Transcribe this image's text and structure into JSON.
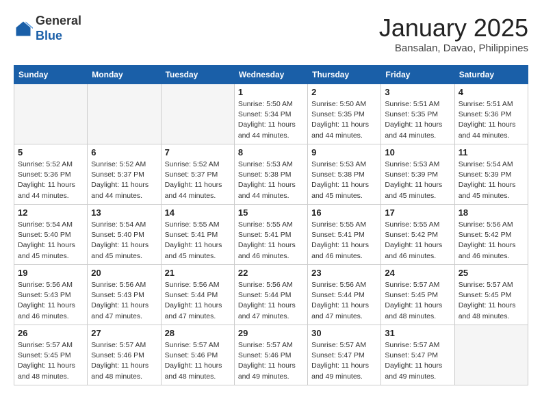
{
  "header": {
    "logo_general": "General",
    "logo_blue": "Blue",
    "month_title": "January 2025",
    "location": "Bansalan, Davao, Philippines"
  },
  "weekdays": [
    "Sunday",
    "Monday",
    "Tuesday",
    "Wednesday",
    "Thursday",
    "Friday",
    "Saturday"
  ],
  "weeks": [
    [
      {
        "day": "",
        "info": ""
      },
      {
        "day": "",
        "info": ""
      },
      {
        "day": "",
        "info": ""
      },
      {
        "day": "1",
        "info": "Sunrise: 5:50 AM\nSunset: 5:34 PM\nDaylight: 11 hours\nand 44 minutes."
      },
      {
        "day": "2",
        "info": "Sunrise: 5:50 AM\nSunset: 5:35 PM\nDaylight: 11 hours\nand 44 minutes."
      },
      {
        "day": "3",
        "info": "Sunrise: 5:51 AM\nSunset: 5:35 PM\nDaylight: 11 hours\nand 44 minutes."
      },
      {
        "day": "4",
        "info": "Sunrise: 5:51 AM\nSunset: 5:36 PM\nDaylight: 11 hours\nand 44 minutes."
      }
    ],
    [
      {
        "day": "5",
        "info": "Sunrise: 5:52 AM\nSunset: 5:36 PM\nDaylight: 11 hours\nand 44 minutes."
      },
      {
        "day": "6",
        "info": "Sunrise: 5:52 AM\nSunset: 5:37 PM\nDaylight: 11 hours\nand 44 minutes."
      },
      {
        "day": "7",
        "info": "Sunrise: 5:52 AM\nSunset: 5:37 PM\nDaylight: 11 hours\nand 44 minutes."
      },
      {
        "day": "8",
        "info": "Sunrise: 5:53 AM\nSunset: 5:38 PM\nDaylight: 11 hours\nand 44 minutes."
      },
      {
        "day": "9",
        "info": "Sunrise: 5:53 AM\nSunset: 5:38 PM\nDaylight: 11 hours\nand 45 minutes."
      },
      {
        "day": "10",
        "info": "Sunrise: 5:53 AM\nSunset: 5:39 PM\nDaylight: 11 hours\nand 45 minutes."
      },
      {
        "day": "11",
        "info": "Sunrise: 5:54 AM\nSunset: 5:39 PM\nDaylight: 11 hours\nand 45 minutes."
      }
    ],
    [
      {
        "day": "12",
        "info": "Sunrise: 5:54 AM\nSunset: 5:40 PM\nDaylight: 11 hours\nand 45 minutes."
      },
      {
        "day": "13",
        "info": "Sunrise: 5:54 AM\nSunset: 5:40 PM\nDaylight: 11 hours\nand 45 minutes."
      },
      {
        "day": "14",
        "info": "Sunrise: 5:55 AM\nSunset: 5:41 PM\nDaylight: 11 hours\nand 45 minutes."
      },
      {
        "day": "15",
        "info": "Sunrise: 5:55 AM\nSunset: 5:41 PM\nDaylight: 11 hours\nand 46 minutes."
      },
      {
        "day": "16",
        "info": "Sunrise: 5:55 AM\nSunset: 5:41 PM\nDaylight: 11 hours\nand 46 minutes."
      },
      {
        "day": "17",
        "info": "Sunrise: 5:55 AM\nSunset: 5:42 PM\nDaylight: 11 hours\nand 46 minutes."
      },
      {
        "day": "18",
        "info": "Sunrise: 5:56 AM\nSunset: 5:42 PM\nDaylight: 11 hours\nand 46 minutes."
      }
    ],
    [
      {
        "day": "19",
        "info": "Sunrise: 5:56 AM\nSunset: 5:43 PM\nDaylight: 11 hours\nand 46 minutes."
      },
      {
        "day": "20",
        "info": "Sunrise: 5:56 AM\nSunset: 5:43 PM\nDaylight: 11 hours\nand 47 minutes."
      },
      {
        "day": "21",
        "info": "Sunrise: 5:56 AM\nSunset: 5:44 PM\nDaylight: 11 hours\nand 47 minutes."
      },
      {
        "day": "22",
        "info": "Sunrise: 5:56 AM\nSunset: 5:44 PM\nDaylight: 11 hours\nand 47 minutes."
      },
      {
        "day": "23",
        "info": "Sunrise: 5:56 AM\nSunset: 5:44 PM\nDaylight: 11 hours\nand 47 minutes."
      },
      {
        "day": "24",
        "info": "Sunrise: 5:57 AM\nSunset: 5:45 PM\nDaylight: 11 hours\nand 48 minutes."
      },
      {
        "day": "25",
        "info": "Sunrise: 5:57 AM\nSunset: 5:45 PM\nDaylight: 11 hours\nand 48 minutes."
      }
    ],
    [
      {
        "day": "26",
        "info": "Sunrise: 5:57 AM\nSunset: 5:45 PM\nDaylight: 11 hours\nand 48 minutes."
      },
      {
        "day": "27",
        "info": "Sunrise: 5:57 AM\nSunset: 5:46 PM\nDaylight: 11 hours\nand 48 minutes."
      },
      {
        "day": "28",
        "info": "Sunrise: 5:57 AM\nSunset: 5:46 PM\nDaylight: 11 hours\nand 48 minutes."
      },
      {
        "day": "29",
        "info": "Sunrise: 5:57 AM\nSunset: 5:46 PM\nDaylight: 11 hours\nand 49 minutes."
      },
      {
        "day": "30",
        "info": "Sunrise: 5:57 AM\nSunset: 5:47 PM\nDaylight: 11 hours\nand 49 minutes."
      },
      {
        "day": "31",
        "info": "Sunrise: 5:57 AM\nSunset: 5:47 PM\nDaylight: 11 hours\nand 49 minutes."
      },
      {
        "day": "",
        "info": ""
      }
    ]
  ]
}
